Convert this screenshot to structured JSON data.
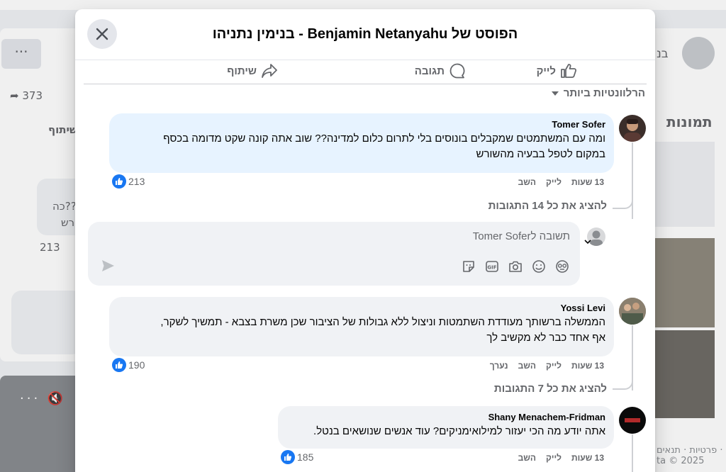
{
  "background": {
    "share_count": "373",
    "share_label": "שיתוף",
    "frag1": "כה??",
    "frag2": "רש",
    "frag_count": "213",
    "right_title": "תמונות",
    "right_name": "בנ",
    "footer": "פרטיות · תנאים · ta © 2025"
  },
  "modal": {
    "title": "הפוסט של Benjamin Netanyahu - בנימין נתניהו"
  },
  "actions": {
    "like": "לייק",
    "comment": "תגובה",
    "share": "שיתוף"
  },
  "sort": {
    "label": "הרלוונטיות ביותר"
  },
  "comments": [
    {
      "author": "Tomer Sofer",
      "text_line1": "ומה עם המשתמטים שמקבלים בונוסים בלי לתרום כלום למדינה?? שוב אתה קונה שקט מדומה בכסף",
      "text_line2": "במקום לטפל בבעיה מהשורש",
      "time": "13 שעות",
      "like": "לייק",
      "reply": "השב",
      "edited": "",
      "reactions": "213",
      "view_replies": "להציג את כל 14 התגובות"
    },
    {
      "author": "Yossi Levi",
      "text_line1": "הממשלה ברשותך מעודדת השתמטות וניצול ללא גבולות של הציבור שכן משרת בצבא - תמשיך לשקר,",
      "text_line2": "אף אחד כבר לא מקשיב לך",
      "time": "13 שעות",
      "like": "לייק",
      "reply": "השב",
      "edited": "נערך",
      "reactions": "190",
      "view_replies": "להציג את כל 7 התגובות"
    },
    {
      "author": "Shany Menachem-Fridman",
      "text_line1": "אתה יודע מה הכי יעזור למילואימניקים? עוד אנשים שנושאים בנטל.",
      "time": "13 שעות",
      "like": "לייק",
      "reply": "השב",
      "reactions": "185"
    }
  ],
  "reply_box": {
    "placeholder": "תשובה לTomer Sofer"
  },
  "colors": {
    "accent": "#1877f2",
    "highlight_bubble": "#e7f3ff",
    "bubble": "#f0f2f5",
    "secondary_text": "#65676b"
  }
}
